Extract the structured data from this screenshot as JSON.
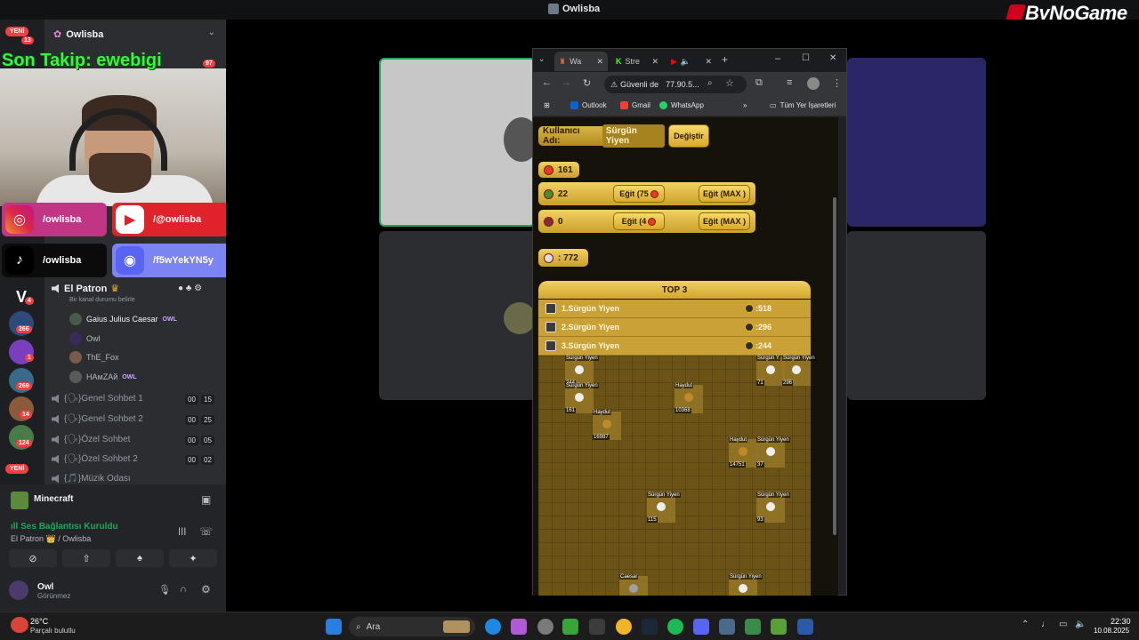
{
  "window_title": "Owlisba",
  "brand": "ByNoGame",
  "stream_overlay": {
    "takip": "Son Takip: ewebigi",
    "socials": {
      "instagram": "/owlisba",
      "youtube": "/@owlisba",
      "tiktok": "/owlisba",
      "discord": "/f5wYekYN5y"
    }
  },
  "rail": {
    "yeni": "YENİ",
    "badges": [
      "13",
      "4",
      "266",
      "1",
      "269",
      "14",
      "124"
    ]
  },
  "sidebar": {
    "server_name": "Owlisba",
    "hidden_badge": "97",
    "voice_channel": "El Patron",
    "voice_status": "Bir kanal durumu belirle",
    "members": [
      {
        "name": "Gaius Julius Caesar",
        "tag": "OWL"
      },
      {
        "name": "Owl",
        "tag": ""
      },
      {
        "name": "ThE_Fox",
        "tag": ""
      },
      {
        "name": "HAмZAй",
        "tag": "OWL"
      }
    ],
    "channels": [
      {
        "name": "{🗣}Genel Sohbet 1",
        "a": "00",
        "b": "15"
      },
      {
        "name": "{🗣}Genel Sohbet 2",
        "a": "00",
        "b": "25"
      },
      {
        "name": "{🗣}Özel Sohbet",
        "a": "00",
        "b": "05"
      },
      {
        "name": "{🗣}Özel Sohbet 2",
        "a": "00",
        "b": "02"
      },
      {
        "name": "{🎵}Müzik Odası",
        "a": "",
        "b": ""
      }
    ]
  },
  "voice_panel": {
    "activity": "Minecraft",
    "status": "Ses Bağlantısı Kuruldu",
    "location": "El Patron 👑 / Owlisba",
    "user": "Owl",
    "user_status": "Görünmez"
  },
  "browser": {
    "tabs": [
      {
        "label": "Wa",
        "icon": "game-icon"
      },
      {
        "label": "Stre",
        "icon": "kick-icon"
      },
      {
        "label": "",
        "icon": "youtube-icon"
      }
    ],
    "security": "Güvenli de",
    "url": "77.90.5...",
    "bookmarks": [
      "Outlook",
      "Gmail",
      "WhatsApp"
    ],
    "all_bookmarks": "Tüm Yer İşaretleri"
  },
  "game": {
    "username_label": "Kullanıcı Adı:",
    "username": "Sürgün Yiyen",
    "change_button": "Değiştir",
    "gold": "161",
    "unit1_count": "22",
    "unit1_train": "Eğit (75",
    "unit2_count": "0",
    "unit2_train": "Eğit (4",
    "train_max": "Eğit (MAX )",
    "timer": ": 772",
    "top_title": "TOP 3",
    "top": [
      {
        "name": "1.Sürgün Yiyen",
        "score": ":518"
      },
      {
        "name": "2.Sürgün Yiyen",
        "score": ":296"
      },
      {
        "name": "3.Sürgün Yiyen",
        "score": ":244"
      }
    ],
    "units": [
      {
        "name": "Sürgün Yiyen",
        "hp": "244"
      },
      {
        "name": "Sürgün Yiyen",
        "hp": "161"
      },
      {
        "name": "Haydut",
        "hp": "16987"
      },
      {
        "name": "Haydut",
        "hp": "10368"
      },
      {
        "name": "Sürgün Y",
        "hp": "71"
      },
      {
        "name": "Sürgün Yiyen",
        "hp": "296"
      },
      {
        "name": "Haydut",
        "hp": "14751"
      },
      {
        "name": "Sürgün Yiyen",
        "hp": "37"
      },
      {
        "name": "Sürgün Yiyen",
        "hp": "115"
      },
      {
        "name": "Sürgün Yiyen",
        "hp": "93"
      },
      {
        "name": "Caesar",
        "hp": ""
      },
      {
        "name": "Sürgün Yiyen",
        "hp": ""
      }
    ]
  },
  "taskbar": {
    "weather_temp": "26°C",
    "weather_desc": "Parçalı bulutlu",
    "search": "Ara",
    "time": "22:30",
    "date": "10.08.2025"
  }
}
